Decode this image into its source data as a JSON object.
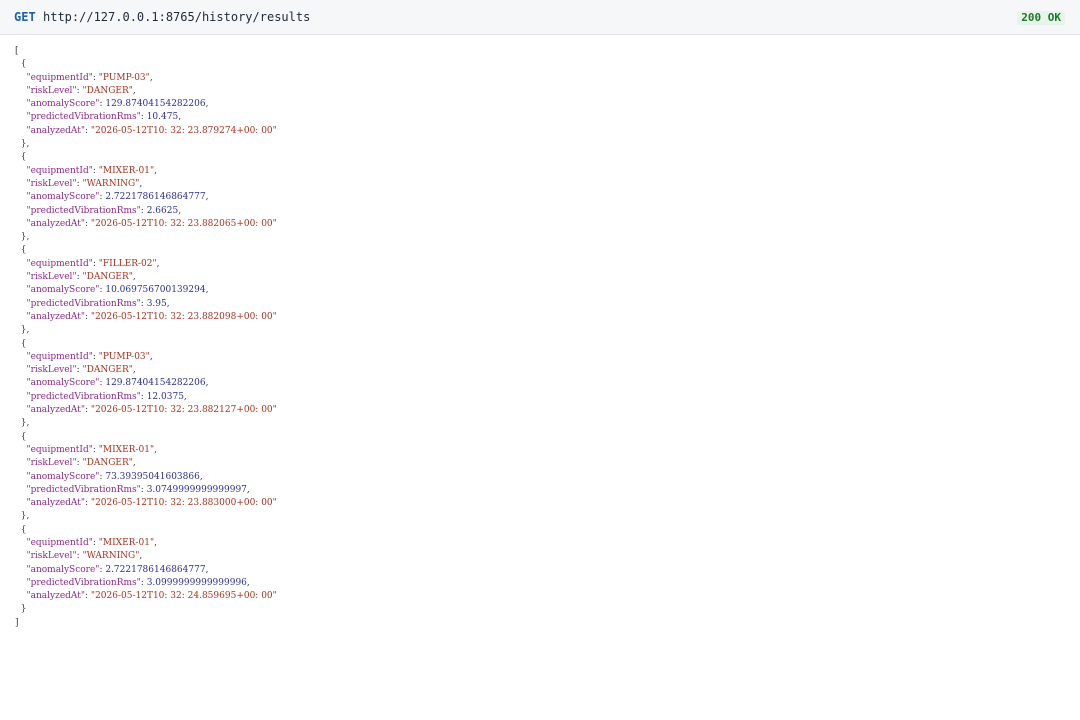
{
  "request": {
    "method": "GET",
    "url": "http://127.0.0.1:8765/history/results",
    "status": "200 OK"
  },
  "colors": {
    "key": "#8a2a86",
    "string": "#a8321f",
    "number": "#2a2f93",
    "method": "#1f5fb4",
    "status_ok": "#1c7a2c"
  },
  "response": [
    {
      "equipmentId": "PUMP-03",
      "riskLevel": "DANGER",
      "anomalyScore": "129.87404154282206",
      "predictedVibrationRms": "10.475",
      "analyzedAt": "2026-05-12T10: 32: 23.879274+00: 00"
    },
    {
      "equipmentId": "MIXER-01",
      "riskLevel": "WARNING",
      "anomalyScore": "2.7221786146864777",
      "predictedVibrationRms": "2.6625",
      "analyzedAt": "2026-05-12T10: 32: 23.882065+00: 00"
    },
    {
      "equipmentId": "FILLER-02",
      "riskLevel": "DANGER",
      "anomalyScore": "10.069756700139294",
      "predictedVibrationRms": "3.95",
      "analyzedAt": "2026-05-12T10: 32: 23.882098+00: 00"
    },
    {
      "equipmentId": "PUMP-03",
      "riskLevel": "DANGER",
      "anomalyScore": "129.87404154282206",
      "predictedVibrationRms": "12.0375",
      "analyzedAt": "2026-05-12T10: 32: 23.882127+00: 00"
    },
    {
      "equipmentId": "MIXER-01",
      "riskLevel": "DANGER",
      "anomalyScore": "73.39395041603866",
      "predictedVibrationRms": "3.0749999999999997",
      "analyzedAt": "2026-05-12T10: 32: 23.883000+00: 00"
    },
    {
      "equipmentId": "MIXER-01",
      "riskLevel": "WARNING",
      "anomalyScore": "2.7221786146864777",
      "predictedVibrationRms": "3.0999999999999996",
      "analyzedAt": "2026-05-12T10: 32: 24.859695+00: 00"
    }
  ]
}
